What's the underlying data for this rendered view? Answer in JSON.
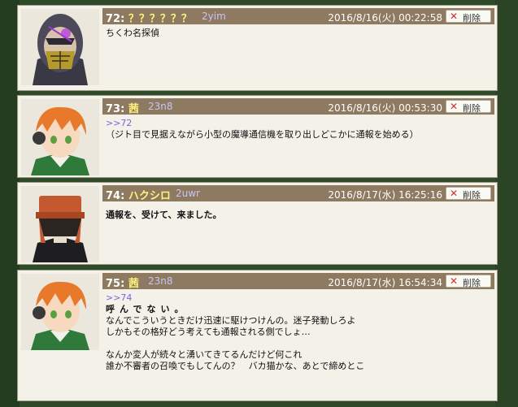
{
  "posts": [
    {
      "number": "72:",
      "name": "？？？？？？",
      "id": "2yim",
      "date": "2016/8/16(火) 00:22:58",
      "delete_label": "削除",
      "avatar_icon": "masked-character-avatar",
      "reply": "",
      "lines": [
        "ちくわ名探偵"
      ]
    },
    {
      "number": "73:",
      "name": "茜",
      "id": "23n8",
      "date": "2016/8/16(火) 00:53:30",
      "delete_label": "削除",
      "avatar_icon": "orange-hair-avatar",
      "reply": ">>72",
      "lines": [
        "（ジト目で見据えながら小型の魔導通信機を取り出しどこかに通報を始める）"
      ]
    },
    {
      "number": "74:",
      "name": "ハクシロ",
      "id": "2uwr",
      "date": "2016/8/17(水) 16:25:16",
      "delete_label": "削除",
      "avatar_icon": "hooded-character-avatar",
      "reply": "",
      "lines": [
        "通報を、受けて、来ました。"
      ]
    },
    {
      "number": "75:",
      "name": "茜",
      "id": "23n8",
      "date": "2016/8/17(水) 16:54:34",
      "delete_label": "削除",
      "avatar_icon": "orange-hair-avatar",
      "reply": ">>74",
      "lines": [
        "呼んでない。",
        "なんでこういうときだけ迅速に駆けつけんの。迷子発動しろよ",
        "しかもその格好どう考えても通報される側でしょ…",
        "",
        "なんか変人が続々と湧いてきてるんだけど何これ",
        "誰か不審者の召喚でもしてんの？　バカ猫かな、あとで締めとこ"
      ]
    }
  ],
  "colors": {
    "header_bg": "#8e7a60",
    "name": "#fff37a",
    "id_text": "#c9c3f6",
    "reply_link": "#7c62e0",
    "delete_x": "#d62d2d",
    "post_bg": "#f4f1e8",
    "page_bg": "#2e4a28"
  }
}
